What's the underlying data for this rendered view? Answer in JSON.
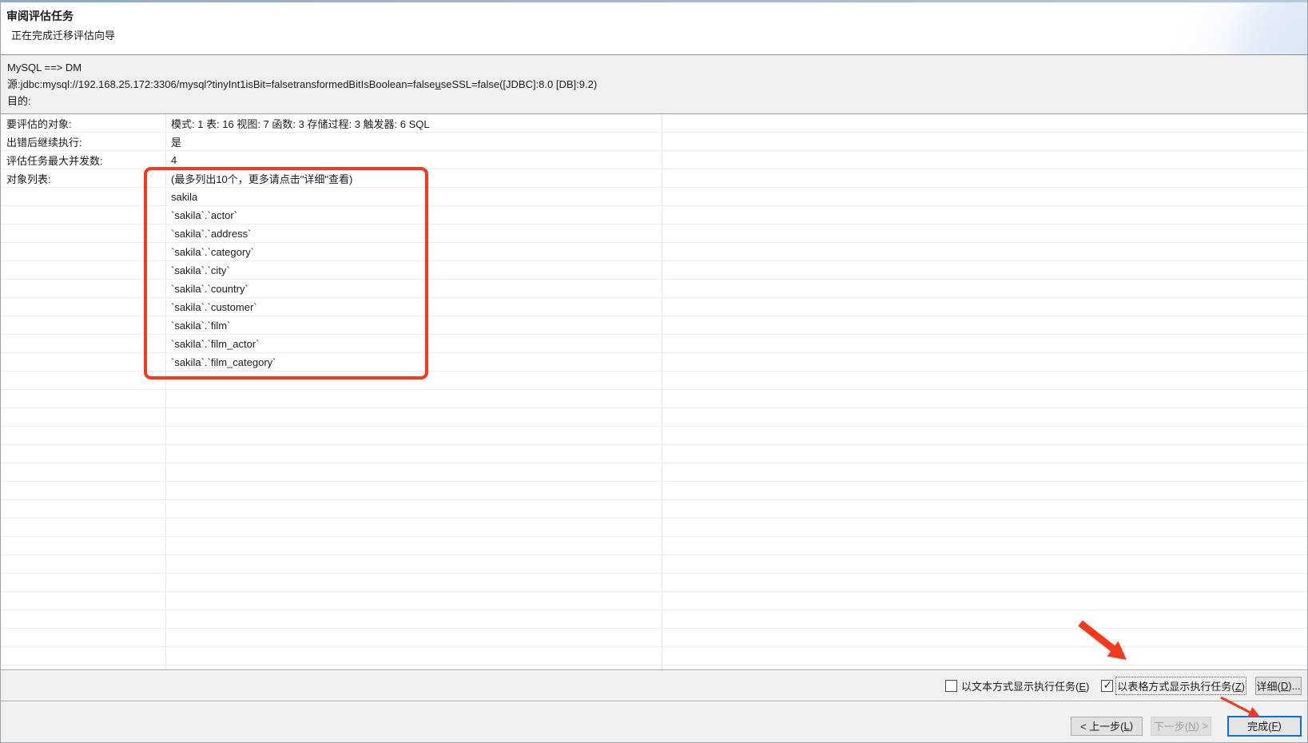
{
  "window": {
    "accent_blue": "#0a6ed8",
    "annotation_red": "#f23b1e"
  },
  "header": {
    "title": "审阅评估任务",
    "subtitle": "正在完成迁移评估向导"
  },
  "info": {
    "route": "MySQL ==> DM",
    "source_prefix": "源:jdbc:mysql://192.168.25.172:3306/mysql?tinyInt1isBit=falsetransformedBitIsBoolean=false",
    "source_mnemonic": "u",
    "source_suffix": "seSSL=false([JDBC]:8.0 [DB]:9.2)",
    "target_label": "目的:"
  },
  "summary": {
    "rows": [
      {
        "label": "要评估的对象:",
        "value": "模式: 1 表: 16 视图: 7 函数: 3 存储过程: 3 触发器: 6 SQL"
      },
      {
        "label": "出错后继续执行:",
        "value": "是"
      },
      {
        "label": "评估任务最大并发数:",
        "value": "4"
      },
      {
        "label": "对象列表:",
        "value": "(最多列出10个，更多请点击\"详细\"查看)"
      }
    ],
    "object_list": [
      "sakila",
      "`sakila`.`actor`",
      "`sakila`.`address`",
      "`sakila`.`category`",
      "`sakila`.`city`",
      "`sakila`.`country`",
      "`sakila`.`customer`",
      "`sakila`.`film`",
      "`sakila`.`film_actor`",
      "`sakila`.`film_category`"
    ]
  },
  "options": {
    "text_mode": {
      "pre": "以文本方式显示执行任务(",
      "key": "E",
      "post": ")",
      "checked": false
    },
    "table_mode": {
      "pre": "以表格方式显示执行任务(",
      "key": "Z",
      "post": ")",
      "checked": true
    },
    "detail": {
      "pre": "详细(",
      "key": "D",
      "post": ")..."
    }
  },
  "nav": {
    "back": {
      "pre": "< 上一步(",
      "key": "L",
      "post": ")"
    },
    "next": {
      "pre": "下一步(",
      "key": "N",
      "post": ") >"
    },
    "finish": {
      "pre": "完成(",
      "key": "F",
      "post": ")"
    }
  }
}
